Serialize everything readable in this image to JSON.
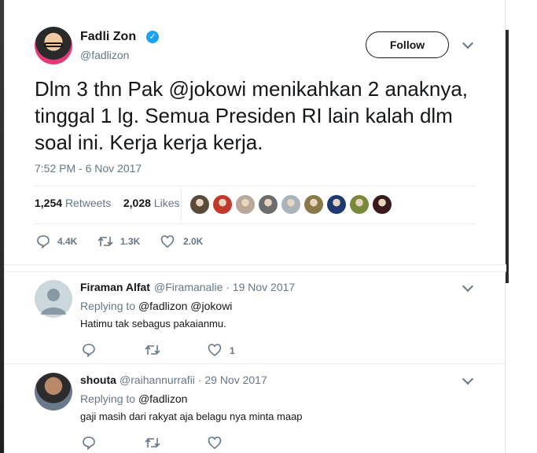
{
  "tweet": {
    "author_name": "Fadli Zon",
    "author_handle": "@fadlizon",
    "follow_label": "Follow",
    "text": "Dlm 3 thn Pak @jokowi menikahkan 2 anaknya, tinggal 1 lg. Semua Presiden RI lain kalah dlm soal ini. Kerja kerja kerja.",
    "timestamp": "7:52 PM - 6 Nov 2017",
    "retweets_count": "1,254",
    "retweets_label": "Retweets",
    "likes_count": "2,028",
    "likes_label": "Likes",
    "actions": {
      "reply_count": "4.4K",
      "retweet_count": "1.3K",
      "like_count": "2.0K"
    },
    "liker_avatar_colors": [
      "#5a4a3a",
      "#c0392b",
      "#b9a99a",
      "#6d6d6d",
      "#a9b4bd",
      "#8a7a4a",
      "#1e3a6e",
      "#7a8a3a",
      "#3a1a1a"
    ]
  },
  "replies": [
    {
      "name": "Firaman Alfat",
      "handle": "@Firamanalie",
      "date": "· 19 Nov 2017",
      "replying_prefix": "Replying to",
      "replying_to": "@fadlizon @jokowi",
      "text": "Hatimu tak sebagus pakaianmu.",
      "like_count": "1"
    },
    {
      "name": "shouta",
      "handle": "@raihannurrafii",
      "date": "· 29 Nov 2017",
      "replying_prefix": "Replying to",
      "replying_to": "@fadlizon",
      "text": "gaji masih dari rakyat aja belagu nya minta maap",
      "like_count": ""
    }
  ],
  "colors": {
    "accent": "#1da1f2",
    "muted": "#657786",
    "text": "#14171a"
  }
}
